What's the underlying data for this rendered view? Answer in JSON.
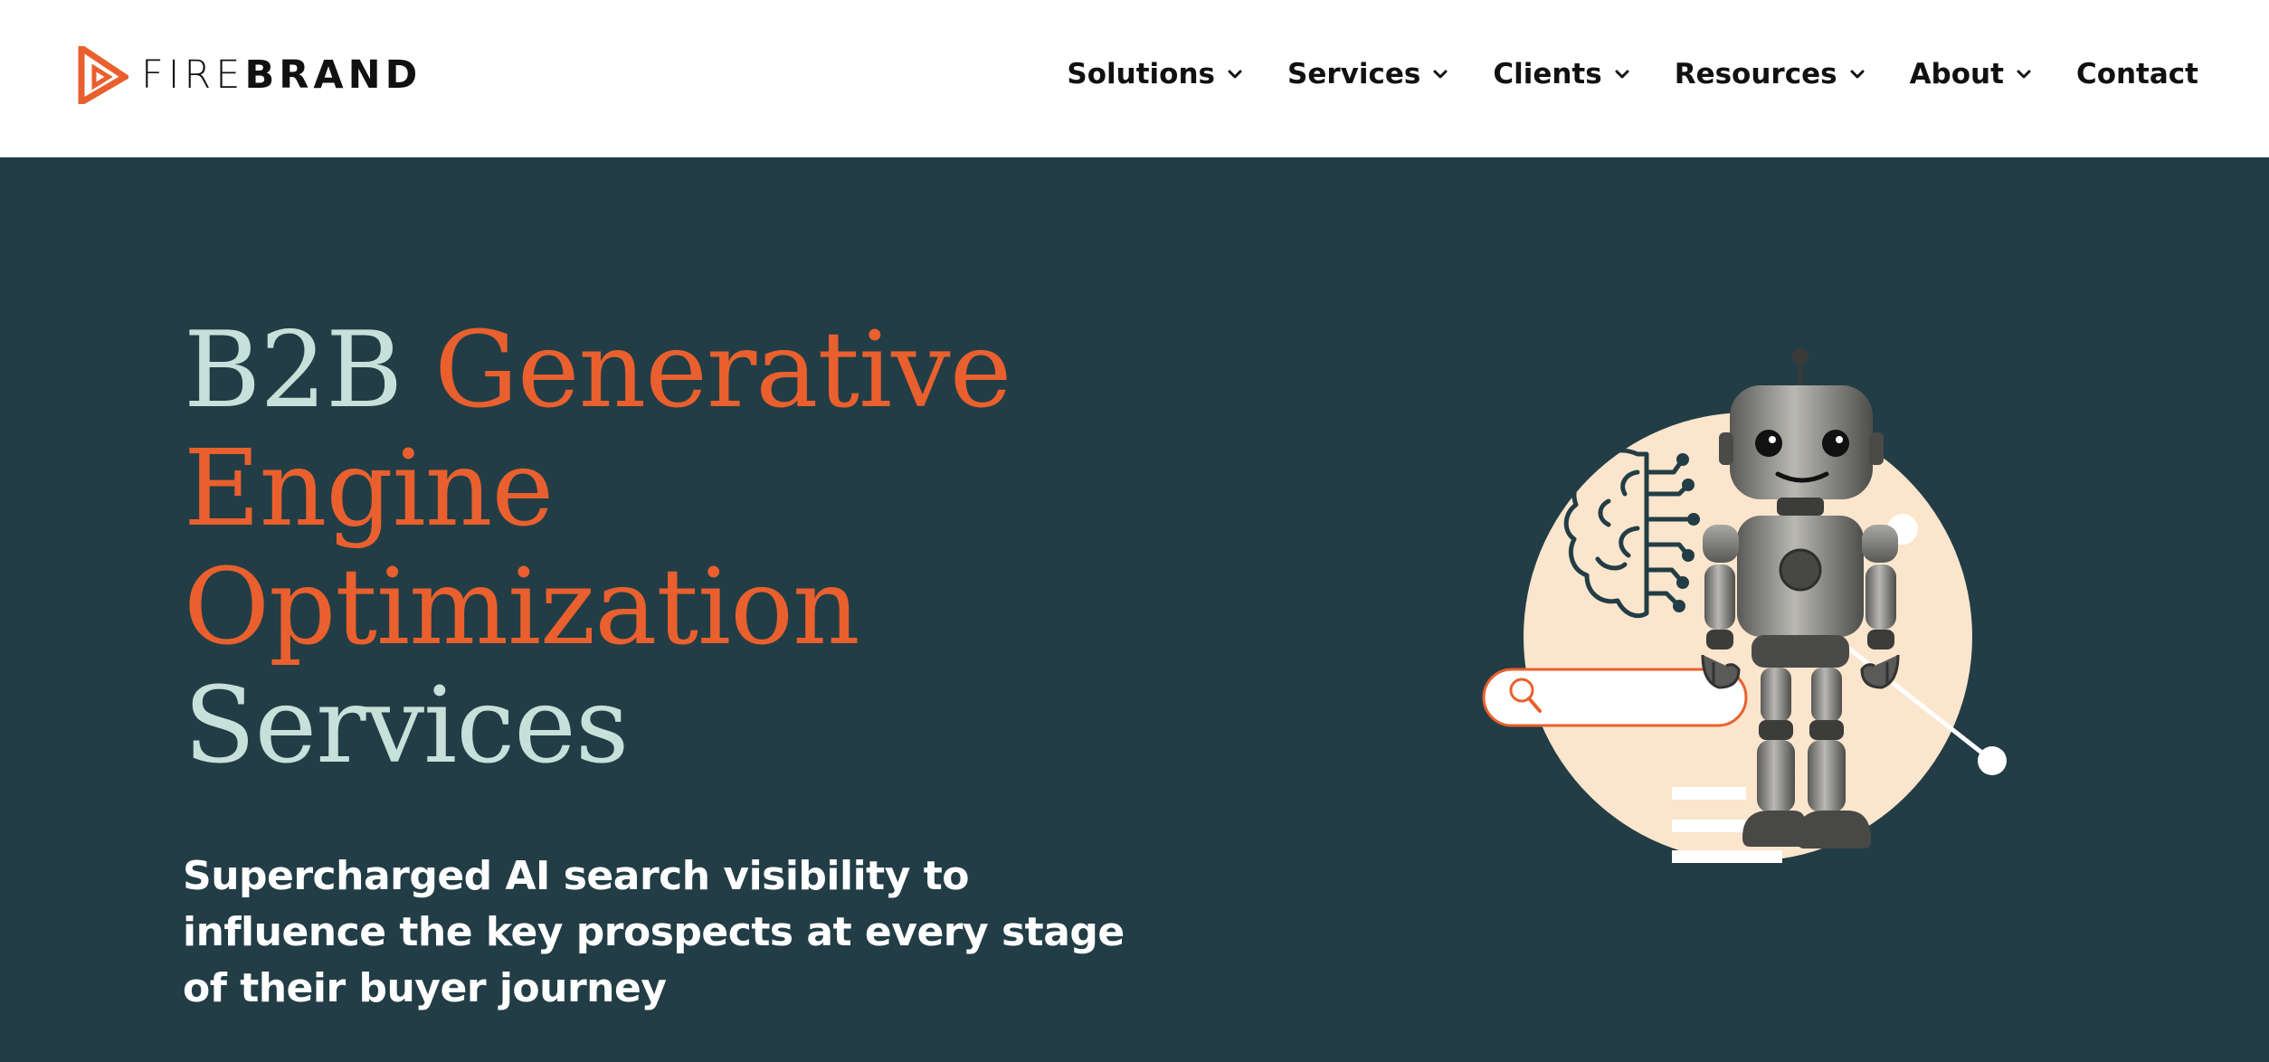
{
  "brand": {
    "logo_light": "FIRE",
    "logo_bold": "BRAND",
    "icon": "play-triangle-logo-icon",
    "accent_color": "#e9602e"
  },
  "nav": {
    "items": [
      {
        "label": "Solutions",
        "has_dropdown": true
      },
      {
        "label": "Services",
        "has_dropdown": true
      },
      {
        "label": "Clients",
        "has_dropdown": true
      },
      {
        "label": "Resources",
        "has_dropdown": true
      },
      {
        "label": "About",
        "has_dropdown": true
      },
      {
        "label": "Contact",
        "has_dropdown": false
      }
    ]
  },
  "hero": {
    "background_color": "#223d45",
    "headline_1": "B2B ",
    "headline_2": "Generative",
    "headline_3": "Engine",
    "headline_4": "Optimization",
    "headline_5": "Services",
    "subhead": "Supercharged AI search visibility to influence the key prospects at every stage of their buyer journey",
    "illustration_icons": [
      "robot-icon",
      "brain-circuit-icon",
      "search-bar-icon",
      "magnifier-icon"
    ]
  }
}
